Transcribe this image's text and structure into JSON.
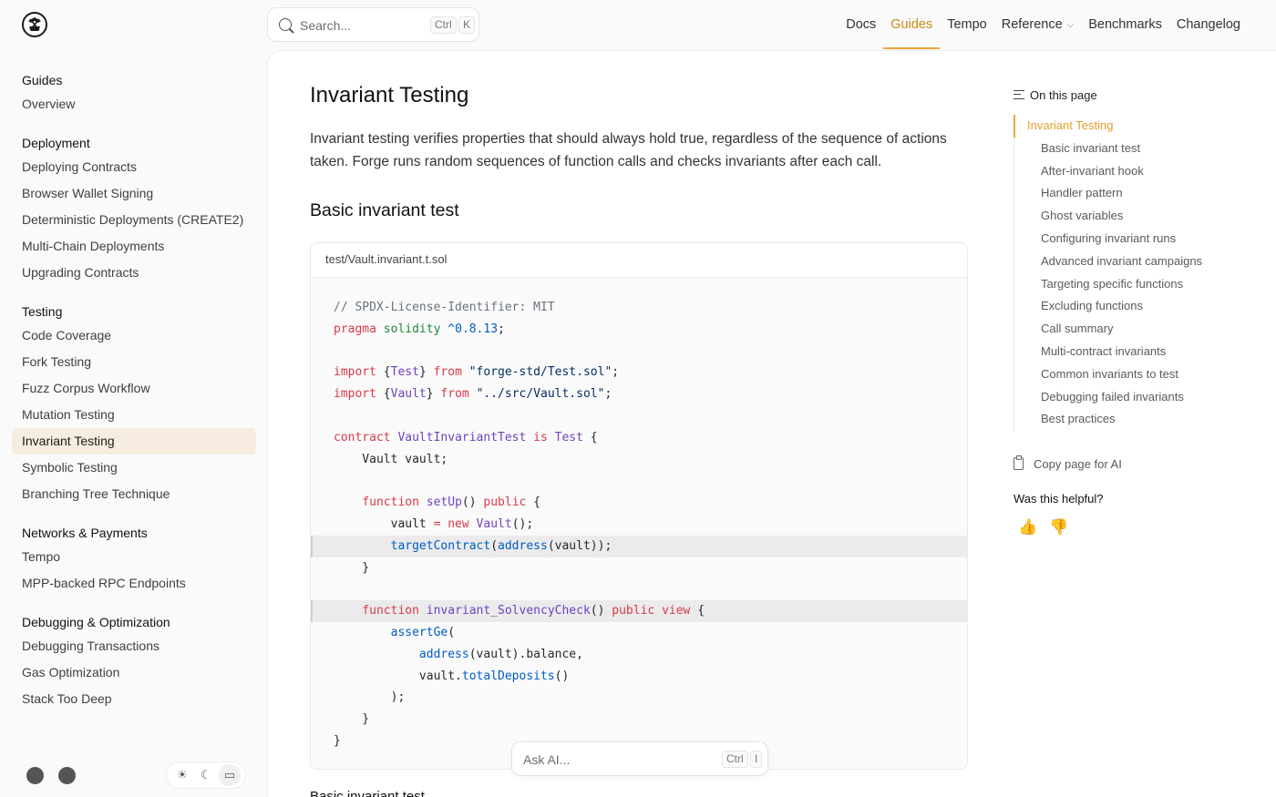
{
  "header": {
    "search_placeholder": "Search...",
    "search_kbd": [
      "Ctrl",
      "K"
    ],
    "nav": [
      {
        "label": "Docs"
      },
      {
        "label": "Guides"
      },
      {
        "label": "Tempo"
      },
      {
        "label": "Reference"
      },
      {
        "label": "Benchmarks"
      },
      {
        "label": "Changelog"
      }
    ],
    "active_nav": "Guides"
  },
  "sidebar": {
    "sections": [
      {
        "heading": "Guides",
        "items": [
          "Overview"
        ]
      },
      {
        "heading": "Deployment",
        "items": [
          "Deploying Contracts",
          "Browser Wallet Signing",
          "Deterministic Deployments (CREATE2)",
          "Multi-Chain Deployments",
          "Upgrading Contracts"
        ]
      },
      {
        "heading": "Testing",
        "items": [
          "Code Coverage",
          "Fork Testing",
          "Fuzz Corpus Workflow",
          "Mutation Testing",
          "Invariant Testing",
          "Symbolic Testing",
          "Branching Tree Technique"
        ]
      },
      {
        "heading": "Networks & Payments",
        "items": [
          "Tempo",
          "MPP-backed RPC Endpoints"
        ]
      },
      {
        "heading": "Debugging & Optimization",
        "items": [
          "Debugging Transactions",
          "Gas Optimization",
          "Stack Too Deep"
        ]
      }
    ],
    "active_item": "Invariant Testing",
    "theme_icons": {
      "light": "☀",
      "dark": "☾",
      "system": "▭"
    }
  },
  "main": {
    "title": "Invariant Testing",
    "intro": "Invariant testing verifies properties that should always hold true, regardless of the sequence of actions taken. Forge runs random sequences of function calls and checks invariants after each call.",
    "section_title": "Basic invariant test",
    "code_filename": "test/Vault.invariant.t.sol",
    "next_heading": "Basic invariant test",
    "code_lines": [
      {
        "hl": false,
        "tokens": [
          [
            "cm",
            "// SPDX-License-Identifier: MIT"
          ]
        ]
      },
      {
        "hl": false,
        "tokens": [
          [
            "kw",
            "pragma"
          ],
          [
            "pl",
            " "
          ],
          [
            "gr",
            "solidity"
          ],
          [
            "pl",
            " "
          ],
          [
            "ty",
            "^0.8.13"
          ],
          [
            "pl",
            ";"
          ]
        ]
      },
      {
        "hl": false,
        "tokens": [
          [
            "pl",
            ""
          ]
        ]
      },
      {
        "hl": false,
        "tokens": [
          [
            "kw",
            "import"
          ],
          [
            "pl",
            " {"
          ],
          [
            "fn",
            "Test"
          ],
          [
            "pl",
            "} "
          ],
          [
            "kw",
            "from"
          ],
          [
            "pl",
            " "
          ],
          [
            "st",
            "\"forge-std/Test.sol\""
          ],
          [
            "pl",
            ";"
          ]
        ]
      },
      {
        "hl": false,
        "tokens": [
          [
            "kw",
            "import"
          ],
          [
            "pl",
            " {"
          ],
          [
            "fn",
            "Vault"
          ],
          [
            "pl",
            "} "
          ],
          [
            "kw",
            "from"
          ],
          [
            "pl",
            " "
          ],
          [
            "st",
            "\"../src/Vault.sol\""
          ],
          [
            "pl",
            ";"
          ]
        ]
      },
      {
        "hl": false,
        "tokens": [
          [
            "pl",
            ""
          ]
        ]
      },
      {
        "hl": false,
        "tokens": [
          [
            "kw",
            "contract"
          ],
          [
            "pl",
            " "
          ],
          [
            "fn",
            "VaultInvariantTest"
          ],
          [
            "pl",
            " "
          ],
          [
            "kw",
            "is"
          ],
          [
            "pl",
            " "
          ],
          [
            "fn",
            "Test"
          ],
          [
            "pl",
            " {"
          ]
        ]
      },
      {
        "hl": false,
        "tokens": [
          [
            "pl",
            "    Vault vault;"
          ]
        ]
      },
      {
        "hl": false,
        "tokens": [
          [
            "pl",
            ""
          ]
        ]
      },
      {
        "hl": false,
        "tokens": [
          [
            "pl",
            "    "
          ],
          [
            "kw",
            "function"
          ],
          [
            "pl",
            " "
          ],
          [
            "fn",
            "setUp"
          ],
          [
            "pl",
            "() "
          ],
          [
            "kw",
            "public"
          ],
          [
            "pl",
            " {"
          ]
        ]
      },
      {
        "hl": false,
        "tokens": [
          [
            "pl",
            "        vault "
          ],
          [
            "kw",
            "="
          ],
          [
            "pl",
            " "
          ],
          [
            "kw",
            "new"
          ],
          [
            "pl",
            " "
          ],
          [
            "fn",
            "Vault"
          ],
          [
            "pl",
            "();"
          ]
        ]
      },
      {
        "hl": true,
        "tokens": [
          [
            "pl",
            "        "
          ],
          [
            "ty",
            "targetContract"
          ],
          [
            "pl",
            "("
          ],
          [
            "ty",
            "address"
          ],
          [
            "pl",
            "(vault));"
          ]
        ]
      },
      {
        "hl": false,
        "tokens": [
          [
            "pl",
            "    }"
          ]
        ]
      },
      {
        "hl": false,
        "tokens": [
          [
            "pl",
            ""
          ]
        ]
      },
      {
        "hl": true,
        "tokens": [
          [
            "pl",
            "    "
          ],
          [
            "kw",
            "function"
          ],
          [
            "pl",
            " "
          ],
          [
            "fn",
            "invariant_SolvencyCheck"
          ],
          [
            "pl",
            "() "
          ],
          [
            "kw",
            "public"
          ],
          [
            "pl",
            " "
          ],
          [
            "kw",
            "view"
          ],
          [
            "pl",
            " {"
          ]
        ]
      },
      {
        "hl": false,
        "tokens": [
          [
            "pl",
            "        "
          ],
          [
            "ty",
            "assertGe"
          ],
          [
            "pl",
            "("
          ]
        ]
      },
      {
        "hl": false,
        "tokens": [
          [
            "pl",
            "            "
          ],
          [
            "ty",
            "address"
          ],
          [
            "pl",
            "(vault).balance,"
          ]
        ]
      },
      {
        "hl": false,
        "tokens": [
          [
            "pl",
            "            vault."
          ],
          [
            "ty",
            "totalDeposits"
          ],
          [
            "pl",
            "()"
          ]
        ]
      },
      {
        "hl": false,
        "tokens": [
          [
            "pl",
            "        );"
          ]
        ]
      },
      {
        "hl": false,
        "tokens": [
          [
            "pl",
            "    }"
          ]
        ]
      },
      {
        "hl": false,
        "tokens": [
          [
            "pl",
            "}"
          ]
        ]
      }
    ],
    "ask_placeholder": "Ask AI...",
    "ask_kbd": [
      "Ctrl",
      "I"
    ]
  },
  "toc": {
    "heading": "On this page",
    "items": [
      {
        "label": "Invariant Testing",
        "level": 1
      },
      {
        "label": "Basic invariant test",
        "level": 2
      },
      {
        "label": "After-invariant hook",
        "level": 2
      },
      {
        "label": "Handler pattern",
        "level": 2
      },
      {
        "label": "Ghost variables",
        "level": 2
      },
      {
        "label": "Configuring invariant runs",
        "level": 2
      },
      {
        "label": "Advanced invariant campaigns",
        "level": 2
      },
      {
        "label": "Targeting specific functions",
        "level": 2
      },
      {
        "label": "Excluding functions",
        "level": 2
      },
      {
        "label": "Call summary",
        "level": 2
      },
      {
        "label": "Multi-contract invariants",
        "level": 2
      },
      {
        "label": "Common invariants to test",
        "level": 2
      },
      {
        "label": "Debugging failed invariants",
        "level": 2
      },
      {
        "label": "Best practices",
        "level": 2
      }
    ],
    "copy_label": "Copy page for AI",
    "helpful_label": "Was this helpful?",
    "thumbs": {
      "up": "👍",
      "down": "👎"
    }
  },
  "colors": {
    "accent": "#f0a53a",
    "active_bg": "#f6ecdf"
  }
}
